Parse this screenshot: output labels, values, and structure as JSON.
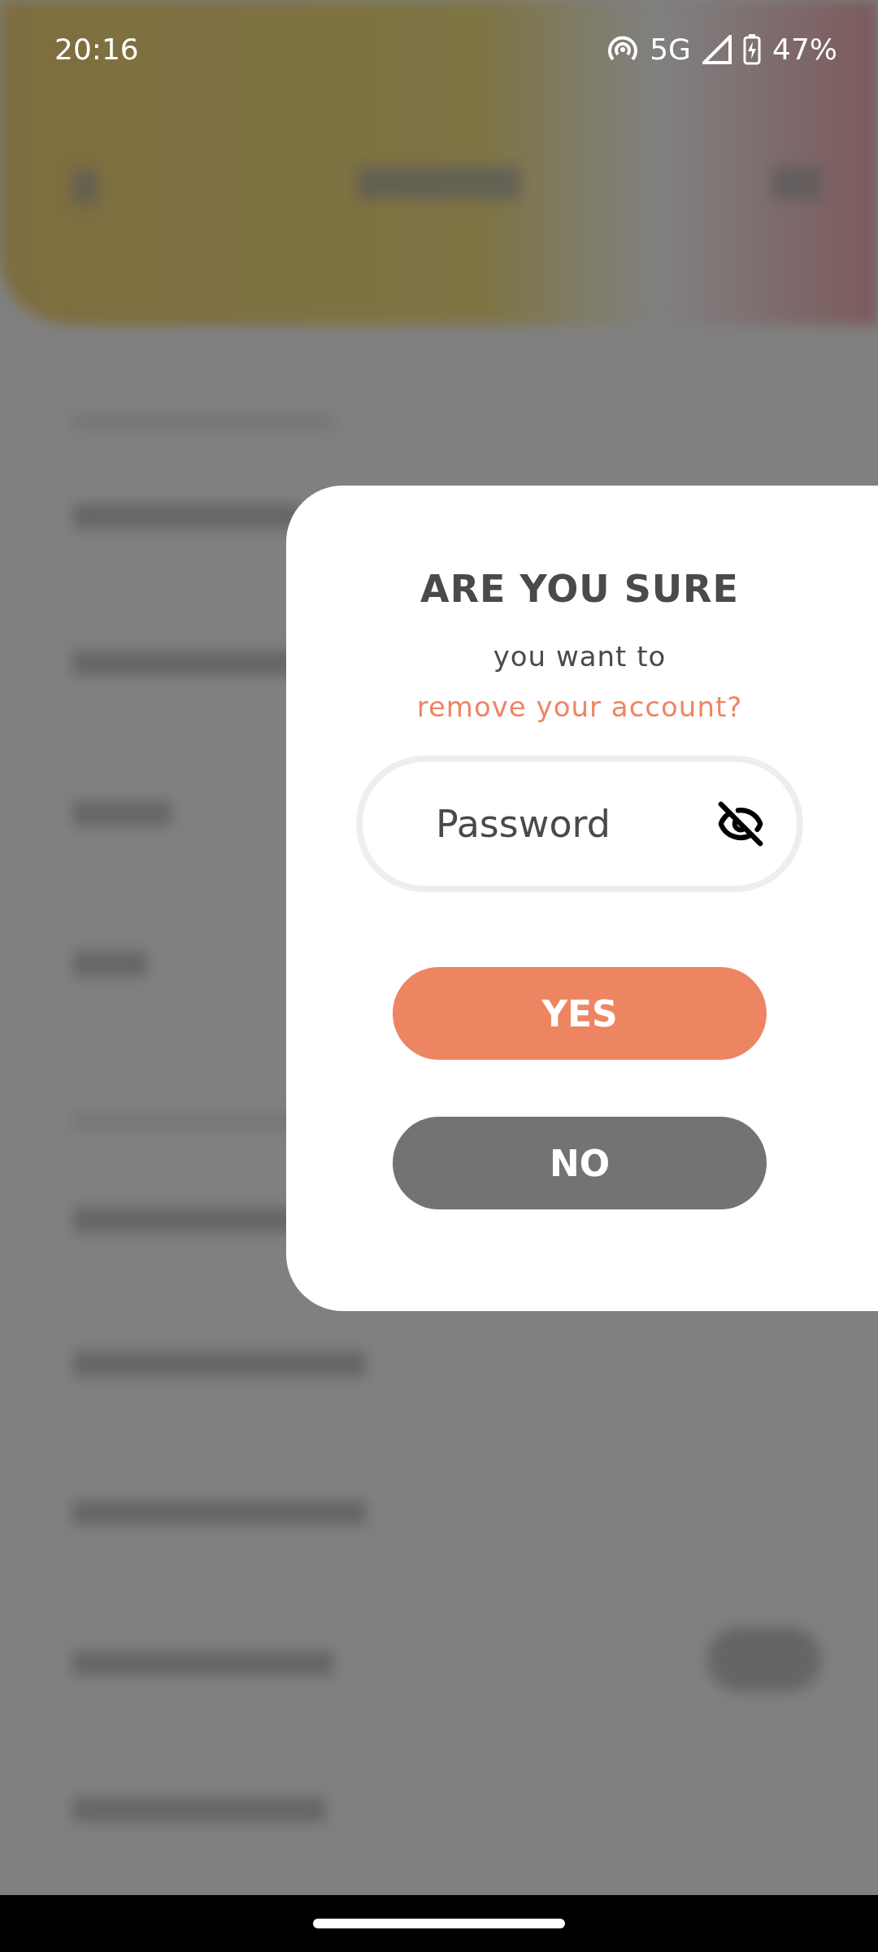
{
  "status_bar": {
    "time": "20:16",
    "network": "5G",
    "battery": "47%"
  },
  "dialog": {
    "title": "ARE YOU SURE",
    "line_1": "you want to",
    "line_2": "remove your account?",
    "password": {
      "placeholder": "Password"
    },
    "buttons": [
      {
        "label": "YES",
        "kind": "confirm"
      },
      {
        "label": "NO",
        "kind": "cancel"
      }
    ]
  }
}
